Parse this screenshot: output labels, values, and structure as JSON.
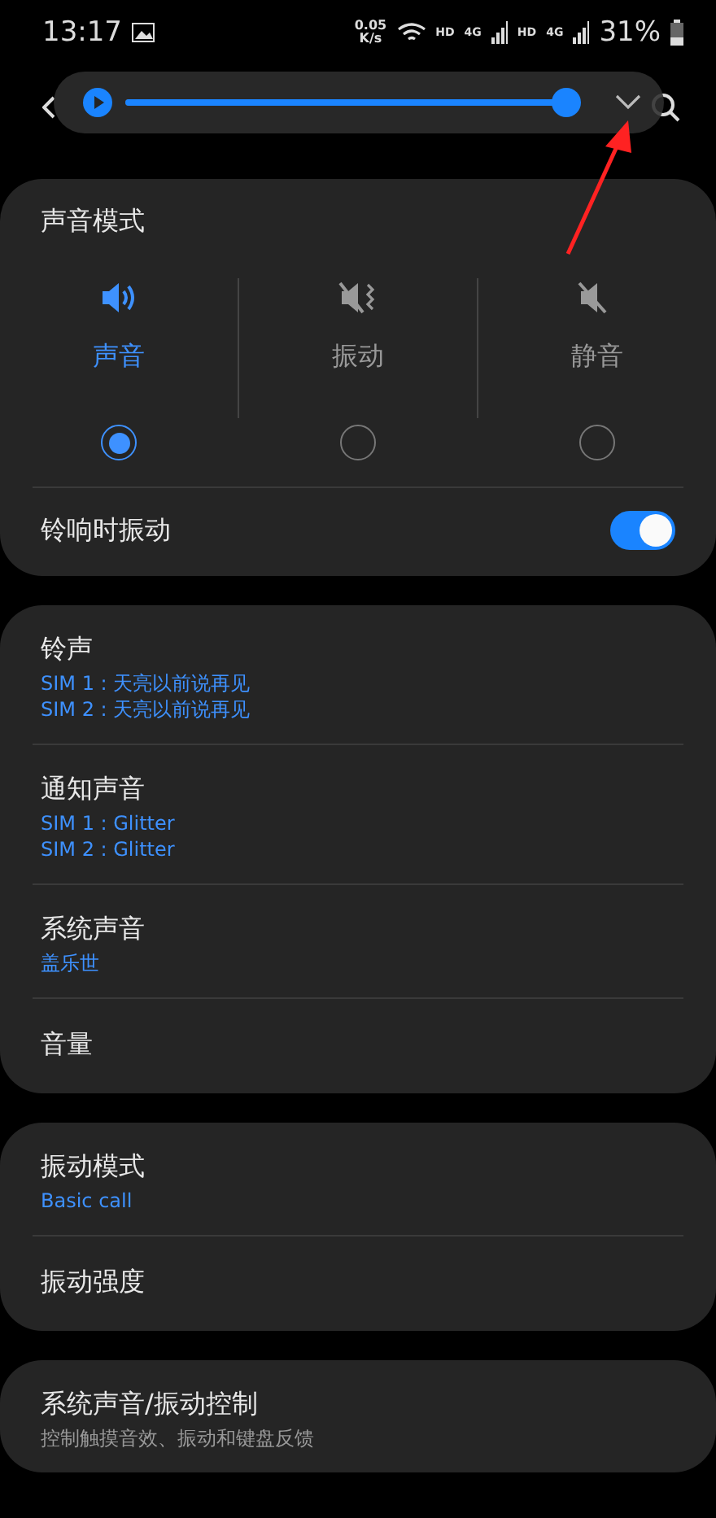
{
  "status_bar": {
    "time": "13:17",
    "speed": [
      "0.05",
      "K/s"
    ],
    "networks": [
      {
        "hd": "HD",
        "gen": "4G"
      },
      {
        "hd": "HD",
        "gen": "4G"
      }
    ],
    "battery": "31%"
  },
  "volume_popup": {
    "level": 0.97,
    "expanded": false
  },
  "sound_mode": {
    "title": "声音模式",
    "modes": [
      {
        "kind": "sound",
        "label": "声音",
        "selected": true
      },
      {
        "kind": "vibrate",
        "label": "振动",
        "selected": false
      },
      {
        "kind": "mute",
        "label": "静音",
        "selected": false
      }
    ],
    "vibrate_while_ringing": {
      "label": "铃响时振动",
      "on": true
    }
  },
  "groups": [
    {
      "items": [
        {
          "title": "铃声",
          "subtitles": [
            "SIM 1 : 天亮以前说再见",
            "SIM 2 : 天亮以前说再见"
          ]
        },
        {
          "title": "通知声音",
          "subtitles": [
            "SIM 1 : Glitter",
            "SIM 2 : Glitter"
          ]
        },
        {
          "title": "系统声音",
          "subtitles": [
            "盖乐世"
          ]
        },
        {
          "title": "音量"
        }
      ]
    },
    {
      "items": [
        {
          "title": "振动模式",
          "subtitles": [
            "Basic call"
          ]
        },
        {
          "title": "振动强度"
        }
      ]
    },
    {
      "items": [
        {
          "title": "系统声音/振动控制",
          "description": "控制触摸音效、振动和键盘反馈"
        }
      ]
    }
  ]
}
